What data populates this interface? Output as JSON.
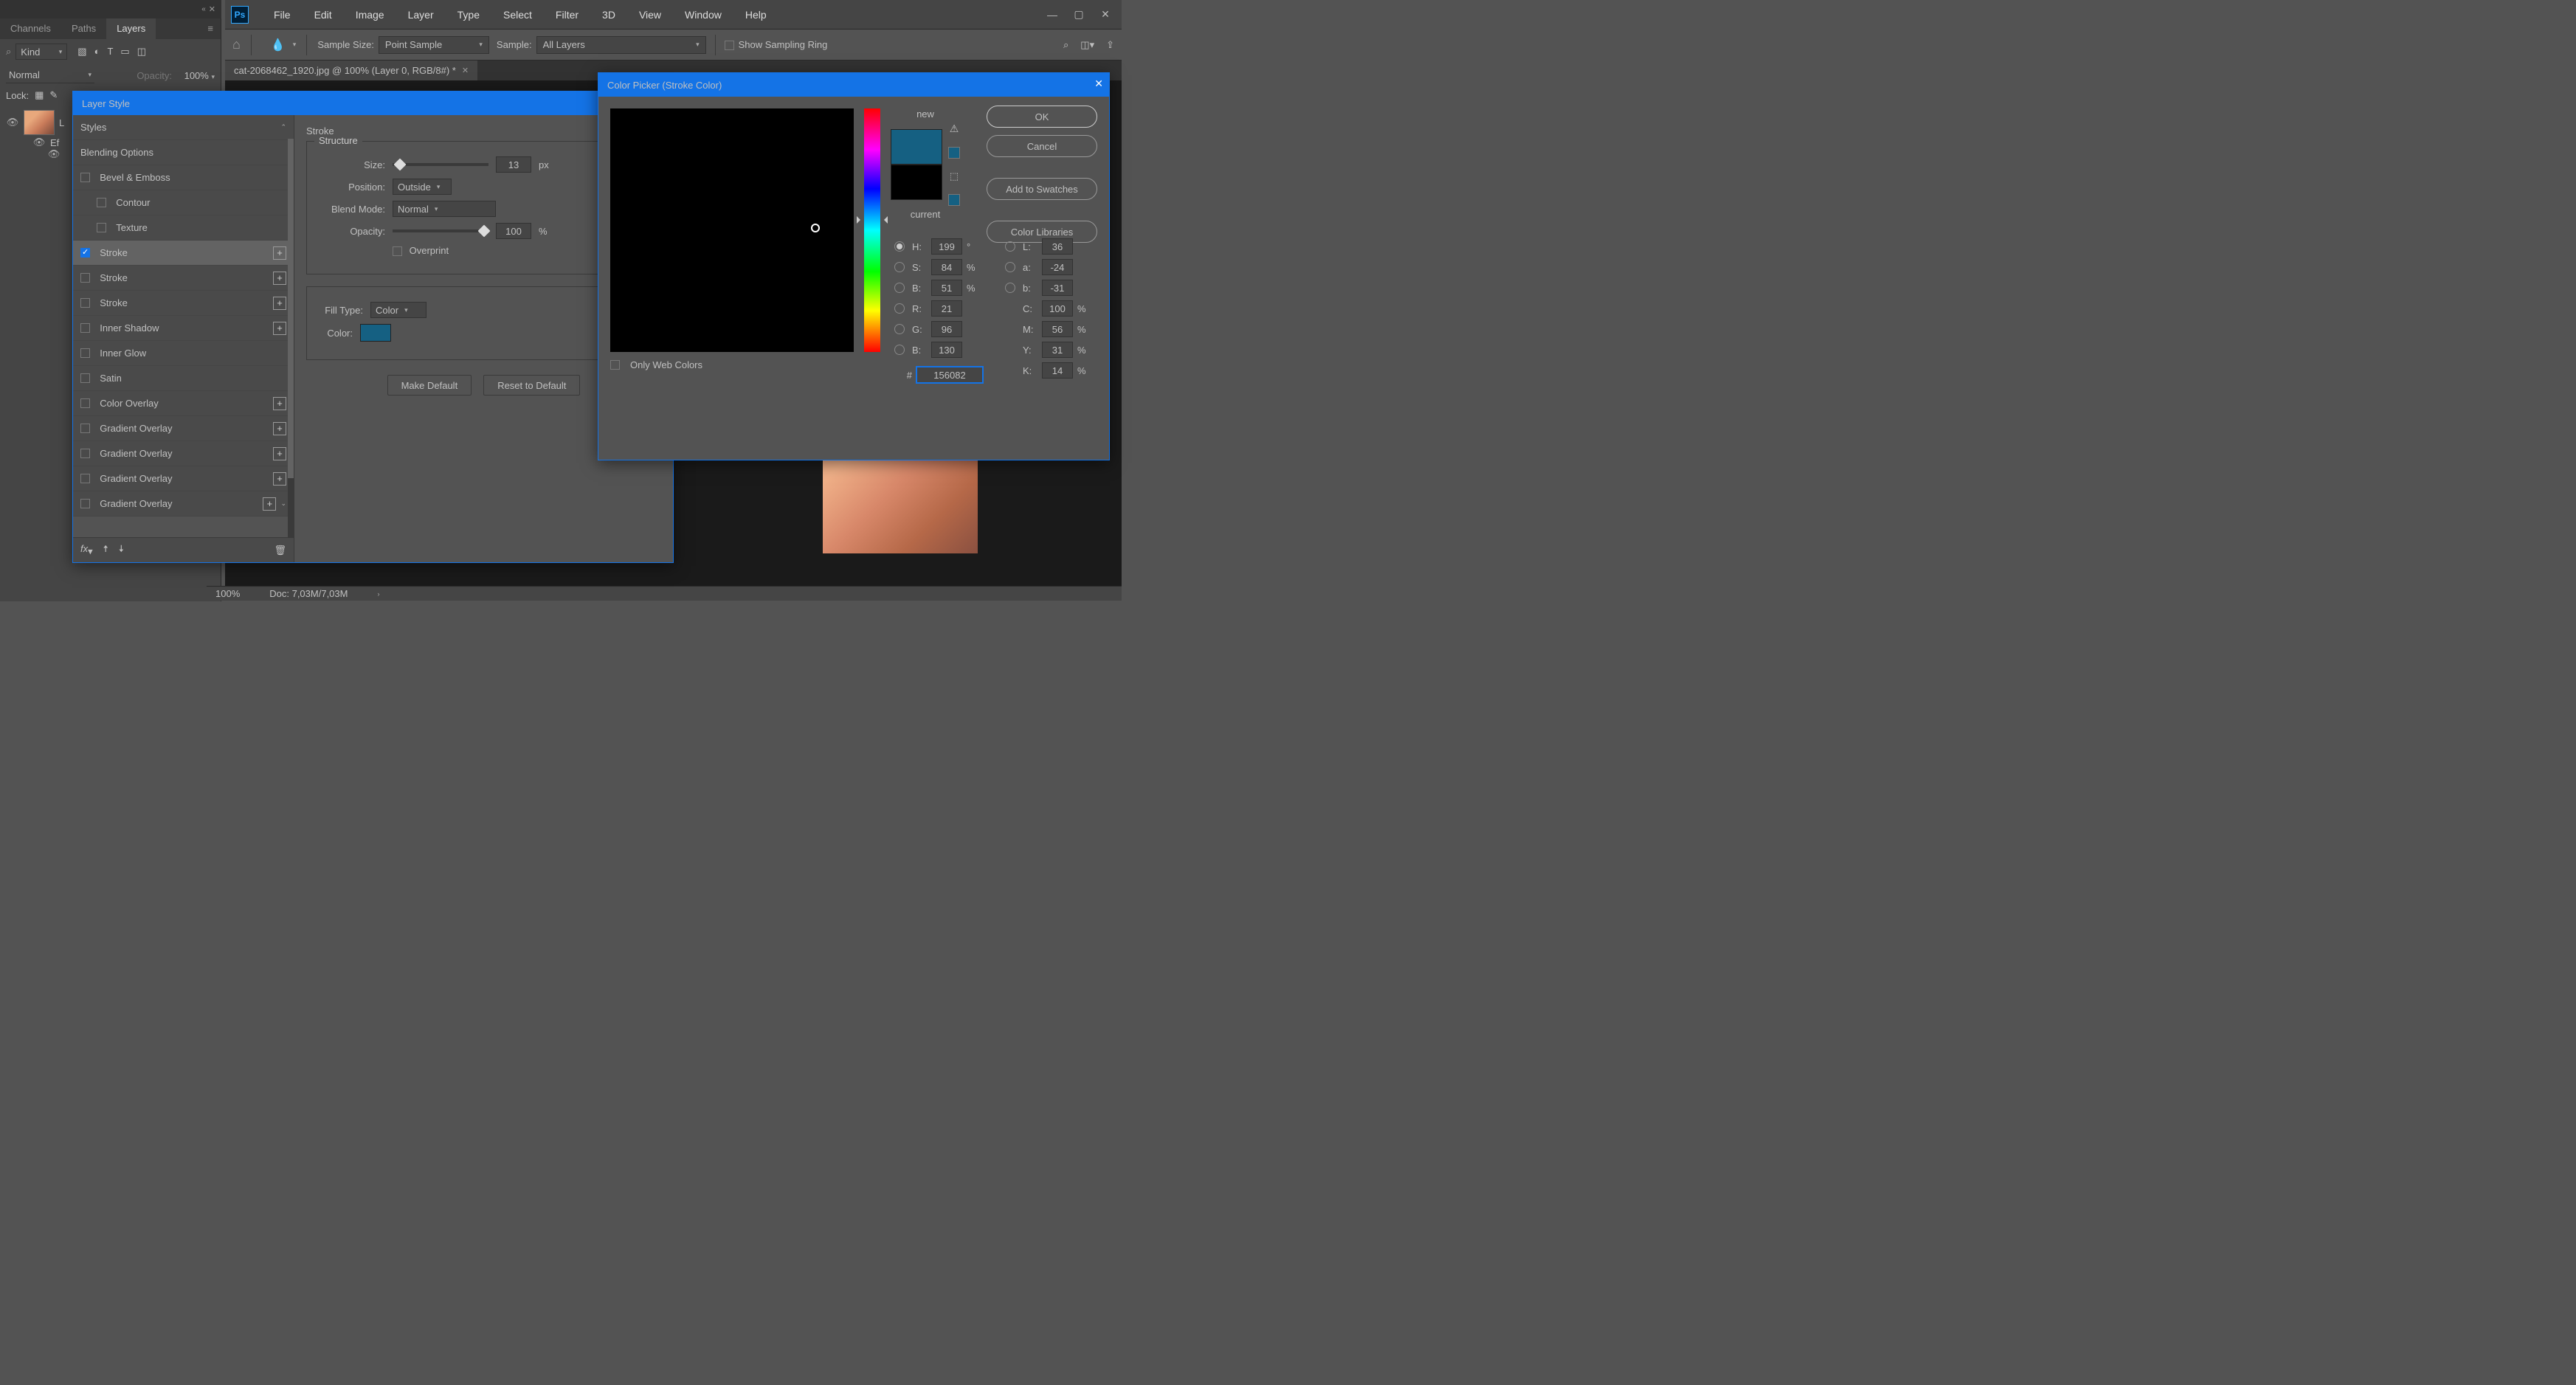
{
  "menubar": {
    "items": [
      "File",
      "Edit",
      "Image",
      "Layer",
      "Type",
      "Select",
      "Filter",
      "3D",
      "View",
      "Window",
      "Help"
    ]
  },
  "options_bar": {
    "sample_size_label": "Sample Size:",
    "sample_size_value": "Point Sample",
    "sample_label": "Sample:",
    "sample_value": "All Layers",
    "show_ring": "Show Sampling Ring"
  },
  "doc_tab": {
    "title": "cat-2068462_1920.jpg @ 100% (Layer 0, RGB/8#) *"
  },
  "status_bar": {
    "zoom": "100%",
    "doc": "Doc: 7,03M/7,03M"
  },
  "panels": {
    "tabs": [
      "Channels",
      "Paths",
      "Layers"
    ],
    "kind": "Kind",
    "blend_mode": "Normal",
    "opacity_label": "Opacity:",
    "opacity_value": "100%",
    "lock_label": "Lock:",
    "layer0": "L",
    "effects": "Ef"
  },
  "layer_style": {
    "title": "Layer Style",
    "styles_header": "Styles",
    "blending_options": "Blending Options",
    "bevel": "Bevel & Emboss",
    "contour": "Contour",
    "texture": "Texture",
    "stroke": "Stroke",
    "stroke2": "Stroke",
    "stroke3": "Stroke",
    "inner_shadow": "Inner Shadow",
    "inner_glow": "Inner Glow",
    "satin": "Satin",
    "color_overlay": "Color Overlay",
    "gradient_overlay": "Gradient Overlay",
    "gradient_overlay2": "Gradient Overlay",
    "gradient_overlay3": "Gradient Overlay",
    "gradient_overlay4": "Gradient Overlay",
    "section": "Stroke",
    "structure": "Structure",
    "size_label": "Size:",
    "size_value": "13",
    "size_unit": "px",
    "position_label": "Position:",
    "position_value": "Outside",
    "blend_label": "Blend Mode:",
    "blend_value": "Normal",
    "opacity_label": "Opacity:",
    "opacity_value": "100",
    "opacity_unit": "%",
    "overprint": "Overprint",
    "fill_label": "Fill Type:",
    "fill_value": "Color",
    "color_label": "Color:",
    "make_default": "Make Default",
    "reset_default": "Reset to Default",
    "stroke_color": "#156082"
  },
  "color_picker": {
    "title": "Color Picker (Stroke Color)",
    "new_label": "new",
    "current_label": "current",
    "ok": "OK",
    "cancel": "Cancel",
    "add_swatches": "Add to Swatches",
    "color_libraries": "Color Libraries",
    "only_web": "Only Web Colors",
    "H_label": "H:",
    "H": "199",
    "H_unit": "°",
    "S_label": "S:",
    "S": "84",
    "S_unit": "%",
    "Bv_label": "B:",
    "Bv": "51",
    "Bv_unit": "%",
    "R_label": "R:",
    "R": "21",
    "G_label": "G:",
    "G": "96",
    "B_label": "B:",
    "B": "130",
    "hex_label": "#",
    "hex": "156082",
    "L_label": "L:",
    "L": "36",
    "a_label": "a:",
    "a": "-24",
    "b2_label": "b:",
    "b2": "-31",
    "C_label": "C:",
    "C": "100",
    "C_unit": "%",
    "M_label": "M:",
    "M": "56",
    "M_unit": "%",
    "Y_label": "Y:",
    "Y": "31",
    "Y_unit": "%",
    "K_label": "K:",
    "K": "14",
    "K_unit": "%",
    "new_color": "#156082",
    "current_color": "#000000"
  }
}
